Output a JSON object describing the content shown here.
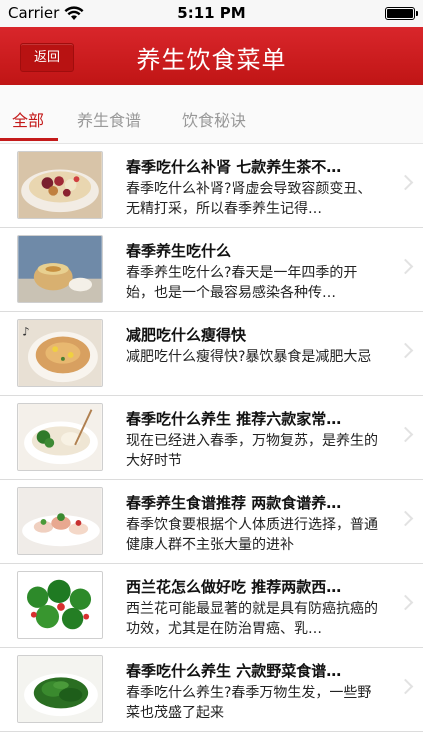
{
  "status_bar": {
    "carrier": "Carrier",
    "time": "5:11 PM"
  },
  "header": {
    "back_label": "返回",
    "title": "养生饮食菜单",
    "accent_color": "#cc1c1c"
  },
  "tabs": [
    {
      "label": "全部",
      "active": true
    },
    {
      "label": "养生食谱",
      "active": false
    },
    {
      "label": "饮食秘诀",
      "active": false
    }
  ],
  "articles": [
    {
      "title": "春季吃什么补肾 七款养生茶不…",
      "desc": "春季吃什么补肾?肾虚会导致容颜变丑、无精打采，所以春季养生记得…"
    },
    {
      "title": "春季养生吃什么",
      "desc": "春季养生吃什么?春天是一年四季的开始，也是一个最容易感染各种传…"
    },
    {
      "title": "减肥吃什么瘦得快",
      "desc": "减肥吃什么瘦得快?暴饮暴食是减肥大忌"
    },
    {
      "title": "春季吃什么养生 推荐六款家常…",
      "desc": "现在已经进入春季，万物复苏，是养生的大好时节"
    },
    {
      "title": "春季养生食谱推荐 两款食谱养…",
      "desc": "春季饮食要根据个人体质进行选择，普通健康人群不主张大量的进补"
    },
    {
      "title": "西兰花怎么做好吃 推荐两款西…",
      "desc": "西兰花可能最显著的就是具有防癌抗癌的功效，尤其是在防治胃癌、乳…"
    },
    {
      "title": "春季吃什么养生 六款野菜食谱…",
      "desc": "春季吃什么养生?春季万物生发，一些野菜也茂盛了起来"
    }
  ]
}
